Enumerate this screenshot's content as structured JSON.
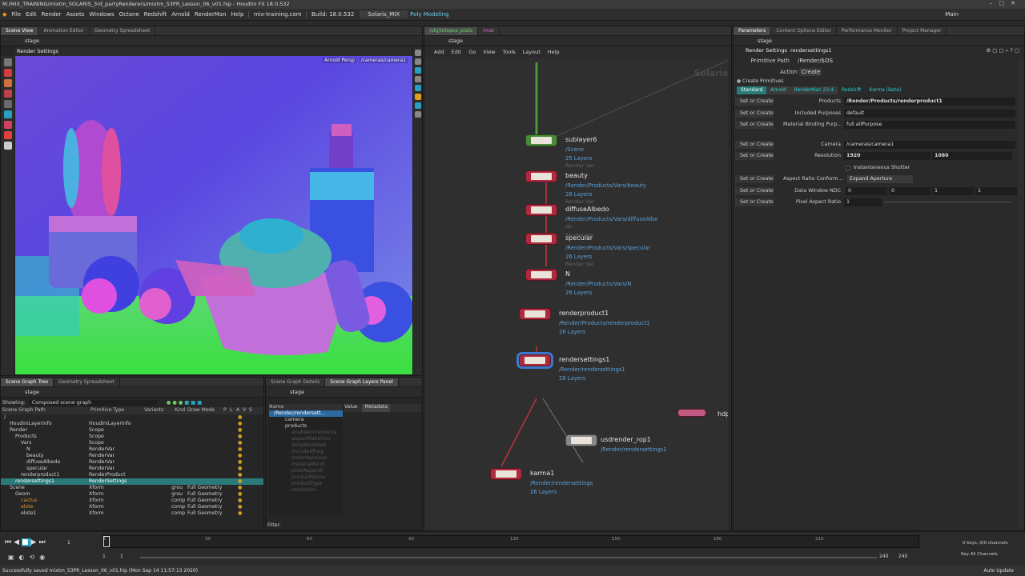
{
  "window": {
    "title": "M:/MIX_TRAINING/mixtm_SOLARIS_3rd_partyRenderers/mixtm_S3PR_Lesson_06_v01.hip - Houdini FX 18.0.532"
  },
  "menubar": {
    "items": [
      "File",
      "Edit",
      "Render",
      "Assets",
      "Windows",
      "Octane",
      "Redshift",
      "Arnold",
      "RenderMan",
      "Help"
    ],
    "site": "mix-training.com",
    "build": "Build: 18.0.532",
    "desktop": "Solaris_MIX",
    "polymodeling": "Poly Modeling",
    "main": "Main"
  },
  "left_top": {
    "tabs": [
      "Scene View",
      "Animation Editor",
      "Geometry Spreadsheet"
    ],
    "path": "stage",
    "viewport_label": "Render Settings",
    "render_label": "Arnold",
    "persp_label": "Persp",
    "camera_label": "/cameras/camera1"
  },
  "scene_graph_tree": {
    "tabs": [
      "Scene Graph Tree",
      "Geometry Spreadsheet"
    ],
    "path": "stage",
    "showing_label": "Showing:",
    "showing_value": "Composed scene graph",
    "columns": [
      "Scene Graph Path",
      "Primitive Type",
      "Variants",
      "Kind",
      "Draw Mode",
      "P",
      "L",
      "A",
      "V",
      "S"
    ],
    "rows": [
      {
        "name": "/",
        "type": "",
        "indent": 0,
        "kind": "",
        "draw": ""
      },
      {
        "name": "HoudiniLayerInfo",
        "type": "HoudiniLayerInfo",
        "indent": 1,
        "kind": "",
        "draw": ""
      },
      {
        "name": "Render",
        "type": "Scope",
        "indent": 1,
        "kind": "",
        "draw": ""
      },
      {
        "name": "Products",
        "type": "Scope",
        "indent": 2,
        "kind": "",
        "draw": ""
      },
      {
        "name": "Vars",
        "type": "Scope",
        "indent": 3,
        "kind": "",
        "draw": ""
      },
      {
        "name": "N",
        "type": "RenderVar",
        "indent": 4,
        "kind": "",
        "draw": ""
      },
      {
        "name": "beauty",
        "type": "RenderVar",
        "indent": 4,
        "kind": "",
        "draw": ""
      },
      {
        "name": "diffuseAlbedo",
        "type": "RenderVar",
        "indent": 4,
        "kind": "",
        "draw": ""
      },
      {
        "name": "specular",
        "type": "RenderVar",
        "indent": 4,
        "kind": "",
        "draw": ""
      },
      {
        "name": "renderproduct1",
        "type": "RenderProduct",
        "indent": 3,
        "kind": "",
        "draw": ""
      },
      {
        "name": "rendersettings1",
        "type": "RenderSettings",
        "indent": 2,
        "kind": "",
        "draw": "",
        "selected": true
      },
      {
        "name": "Scene",
        "type": "Xform",
        "indent": 1,
        "kind": "grou",
        "draw": "Full Geometry"
      },
      {
        "name": "Geom",
        "type": "Xform",
        "indent": 2,
        "kind": "grou",
        "draw": "Full Geometry"
      },
      {
        "name": "cactus",
        "type": "Xform",
        "indent": 3,
        "kind": "comp",
        "draw": "Full Geometry",
        "orange": true
      },
      {
        "name": "elote",
        "type": "Xform",
        "indent": 3,
        "kind": "comp",
        "draw": "Full Geometry",
        "orange": true
      },
      {
        "name": "elote1",
        "type": "Xform",
        "indent": 3,
        "kind": "comp",
        "draw": "Full Geometry"
      }
    ]
  },
  "scene_layers": {
    "tabs": [
      "Scene Graph Details",
      "Scene Graph Layers Panel"
    ],
    "path": "stage",
    "columns": [
      "Name",
      "Value",
      "Metadata"
    ],
    "selected": "/Render/rendersett...",
    "children": [
      "camera",
      "products"
    ],
    "faint": [
      "enableIncrementa",
      "aspectRatioCon",
      "dataWindowN",
      "includedPurp",
      "instantaneous",
      "materialBindi",
      "pixelAspectR",
      "productName",
      "productType",
      "resolution"
    ],
    "filter_label": "Filter:"
  },
  "network": {
    "tabs": [
      "/obj/totopos_plato",
      "/mat"
    ],
    "path": "stage",
    "menu": [
      "Add",
      "Edit",
      "Go",
      "View",
      "Tools",
      "Layout",
      "Help"
    ],
    "context_label": "Solaris",
    "nodes": [
      {
        "name": "sublayer6",
        "path": "/Scene",
        "info": "25 Layers",
        "faint": "Render Var",
        "green": true
      },
      {
        "name": "beauty",
        "path": "/Render/Products/Vars/beauty",
        "info": "26 Layers",
        "faint": "Render Var"
      },
      {
        "name": "diffuseAlbedo",
        "path": "/Render/Products/Vars/diffuseAlbe",
        "path2": "do",
        "faint": "Render Var"
      },
      {
        "name": "specular",
        "path": "/Render/Products/Vars/specular",
        "info": "26 Layers",
        "faint": "Render Var"
      },
      {
        "name": "N",
        "path": "/Render/Products/Vars/N",
        "info": "26 Layers"
      },
      {
        "name": "renderproduct1",
        "path": "/Render/Products/renderproduct1",
        "info": "26 Layers"
      },
      {
        "name": "rendersettings1",
        "path": "/Render/rendersettings1",
        "info": "26 Layers"
      },
      {
        "name": "usdrender_rop1",
        "path": "/Render/rendersettings1",
        "info": ""
      },
      {
        "name": "karma1",
        "path": "/Render/rendersettings",
        "info": "26 Layers"
      },
      {
        "name": "hdprm",
        "path": "",
        "info": ""
      }
    ]
  },
  "params": {
    "tabs": [
      "Parameters",
      "Content Options Editor",
      "Performance Monitor",
      "Project Manager"
    ],
    "path": "stage",
    "header_type": "Render Settings",
    "header_name": "rendersettings1",
    "prim_path_label": "Primitive Path",
    "prim_path_value": "/Render/$OS",
    "action_label": "Action",
    "action_value": "Create",
    "create_primitives": "Create Primitives",
    "renderer_tabs": [
      "Standard",
      "Arnold",
      "RenderMan 23.4",
      "Redshift",
      "Karma (Beta)"
    ],
    "rows": [
      {
        "soc": "Set or Create",
        "label": "Products",
        "value": "/Render/Products/renderproduct1",
        "bold": true
      },
      {
        "soc": "Set or Create",
        "label": "Included Purposes",
        "value": "default"
      },
      {
        "soc": "Set or Create",
        "label": "Material Binding Purp...",
        "value": "full allPurpose"
      },
      {
        "soc": "Set or Create",
        "label": "Camera",
        "value": "/cameras/camera1"
      },
      {
        "soc": "Set or Create",
        "label": "Resolution",
        "value": "1920",
        "value2": "1080"
      },
      {
        "soc": "",
        "label": "",
        "value": "Instantaneous Shutter",
        "checkbox": true
      },
      {
        "soc": "Set or Create",
        "label": "Aspect Ratio Conform...",
        "value": "Expand Aperture",
        "button": true
      },
      {
        "soc": "Set or Create",
        "label": "Data Window NDC",
        "value": "0",
        "value2": "0",
        "value3": "1",
        "value4": "1"
      },
      {
        "soc": "Set or Create",
        "label": "Pixel Aspect Ratio",
        "value": "1",
        "slider": true
      }
    ]
  },
  "timeline": {
    "frame": "1",
    "start": "1",
    "start2": "1",
    "end": "240",
    "end2": "240",
    "ticks": [
      "1",
      "30",
      "60",
      "90",
      "120",
      "150",
      "180",
      "210"
    ],
    "keys_label": "0 keys, 0/0 channels",
    "key_all": "Key All Channels",
    "auto_update": "Auto Update"
  },
  "status": {
    "message": "Successfully saved mixtm_S3PR_Lesson_06_v01.hip (Mon Sep 14 11:57:13 2020)"
  },
  "colors": {
    "accent_blue": "#3a7ad0",
    "node_red": "#b02a3e",
    "node_green": "#4a8a3a",
    "path_blue": "#5aa0d8",
    "selection_teal": "#2aa0a0"
  }
}
